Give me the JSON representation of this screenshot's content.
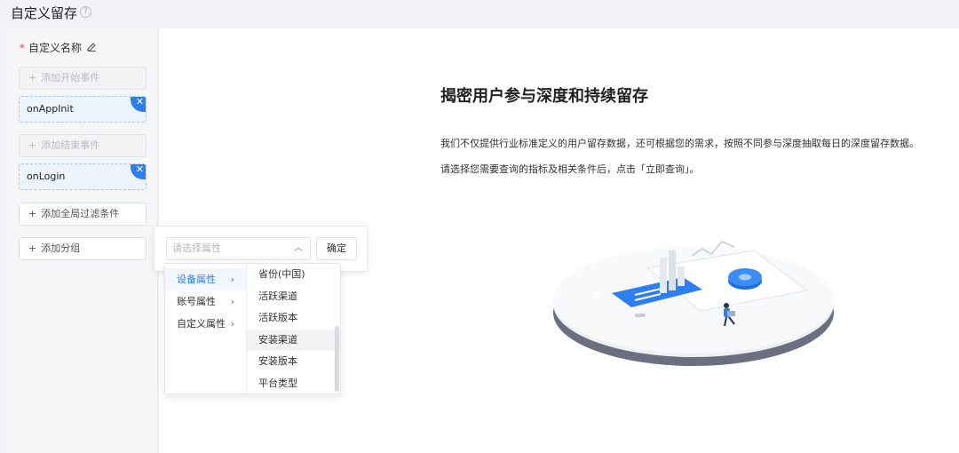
{
  "page": {
    "title": "自定义留存"
  },
  "sidebar": {
    "name_label": "自定义名称",
    "add_start_event": "添加开始事件",
    "start_event": "onAppInit",
    "add_end_event": "添加结束事件",
    "end_event": "onLogin",
    "add_global_filter": "添加全局过滤条件",
    "add_group": "添加分组"
  },
  "popover": {
    "select_placeholder": "请选择属性",
    "confirm_label": "确定"
  },
  "cascader": {
    "categories": [
      "设备属性",
      "账号属性",
      "自定义属性"
    ],
    "options": [
      "省份(中国)",
      "活跃渠道",
      "活跃版本",
      "安装渠道",
      "安装版本",
      "平台类型"
    ]
  },
  "main": {
    "headline": "揭密用户参与深度和持续留存",
    "desc1": "我们不仅提供行业标准定义的用户留存数据，还可根据您的需求，按照不同参与深度抽取每日的深度留存数据。",
    "desc2": "请选择您需要查询的指标及相关条件后，点击「立即查询」。"
  },
  "icons": {
    "help": "question-circle-icon",
    "edit": "pencil-icon",
    "close": "close-icon",
    "plus": "plus-icon",
    "caret": "chevron-up-icon",
    "arrow": "chevron-right-icon"
  },
  "colors": {
    "primary": "#2d7ff0",
    "required": "#e5484d"
  }
}
